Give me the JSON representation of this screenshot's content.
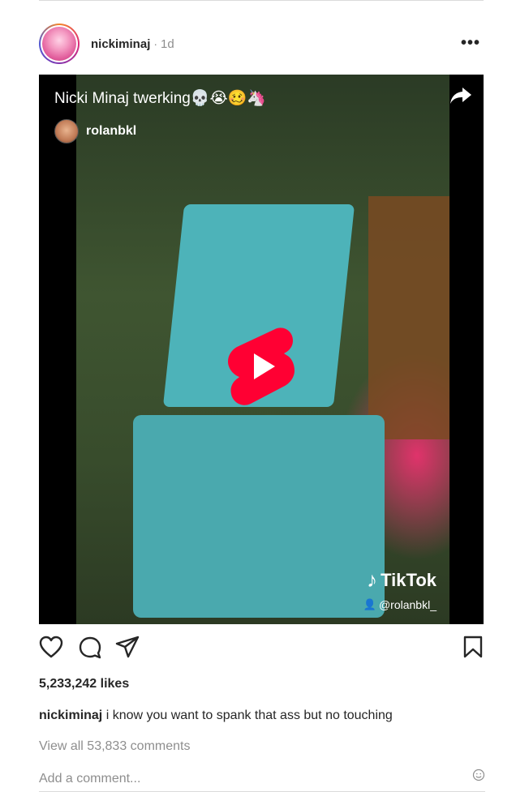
{
  "post": {
    "username": "nickiminaj",
    "time_separator": "·",
    "time": "1d",
    "more_label": "•••"
  },
  "video": {
    "title": "Nicki Minaj twerking💀😭🥴🦄",
    "channel": "rolanbkl",
    "watermark": "TikTok",
    "watermark_glyph": "♪",
    "watermark_user": "@rolanbkl_",
    "watermark_user_glyph": "👤"
  },
  "likes": "5,233,242 likes",
  "caption": {
    "username": "nickiminaj",
    "text": " i know you want to spank that ass but no touching"
  },
  "comments": {
    "view_all": "View all 53,833 comments",
    "placeholder": "Add a comment..."
  },
  "icons": {
    "like": "heart-icon",
    "comment": "comment-icon",
    "share": "send-icon",
    "save": "bookmark-icon",
    "video_share": "share-arrow-icon",
    "play": "youtube-shorts-play-icon",
    "emoji": "emoji-icon"
  },
  "colors": {
    "text": "#262626",
    "muted": "#8e8e8e",
    "divider": "#dbdbdb",
    "play_red": "#ff0033"
  }
}
